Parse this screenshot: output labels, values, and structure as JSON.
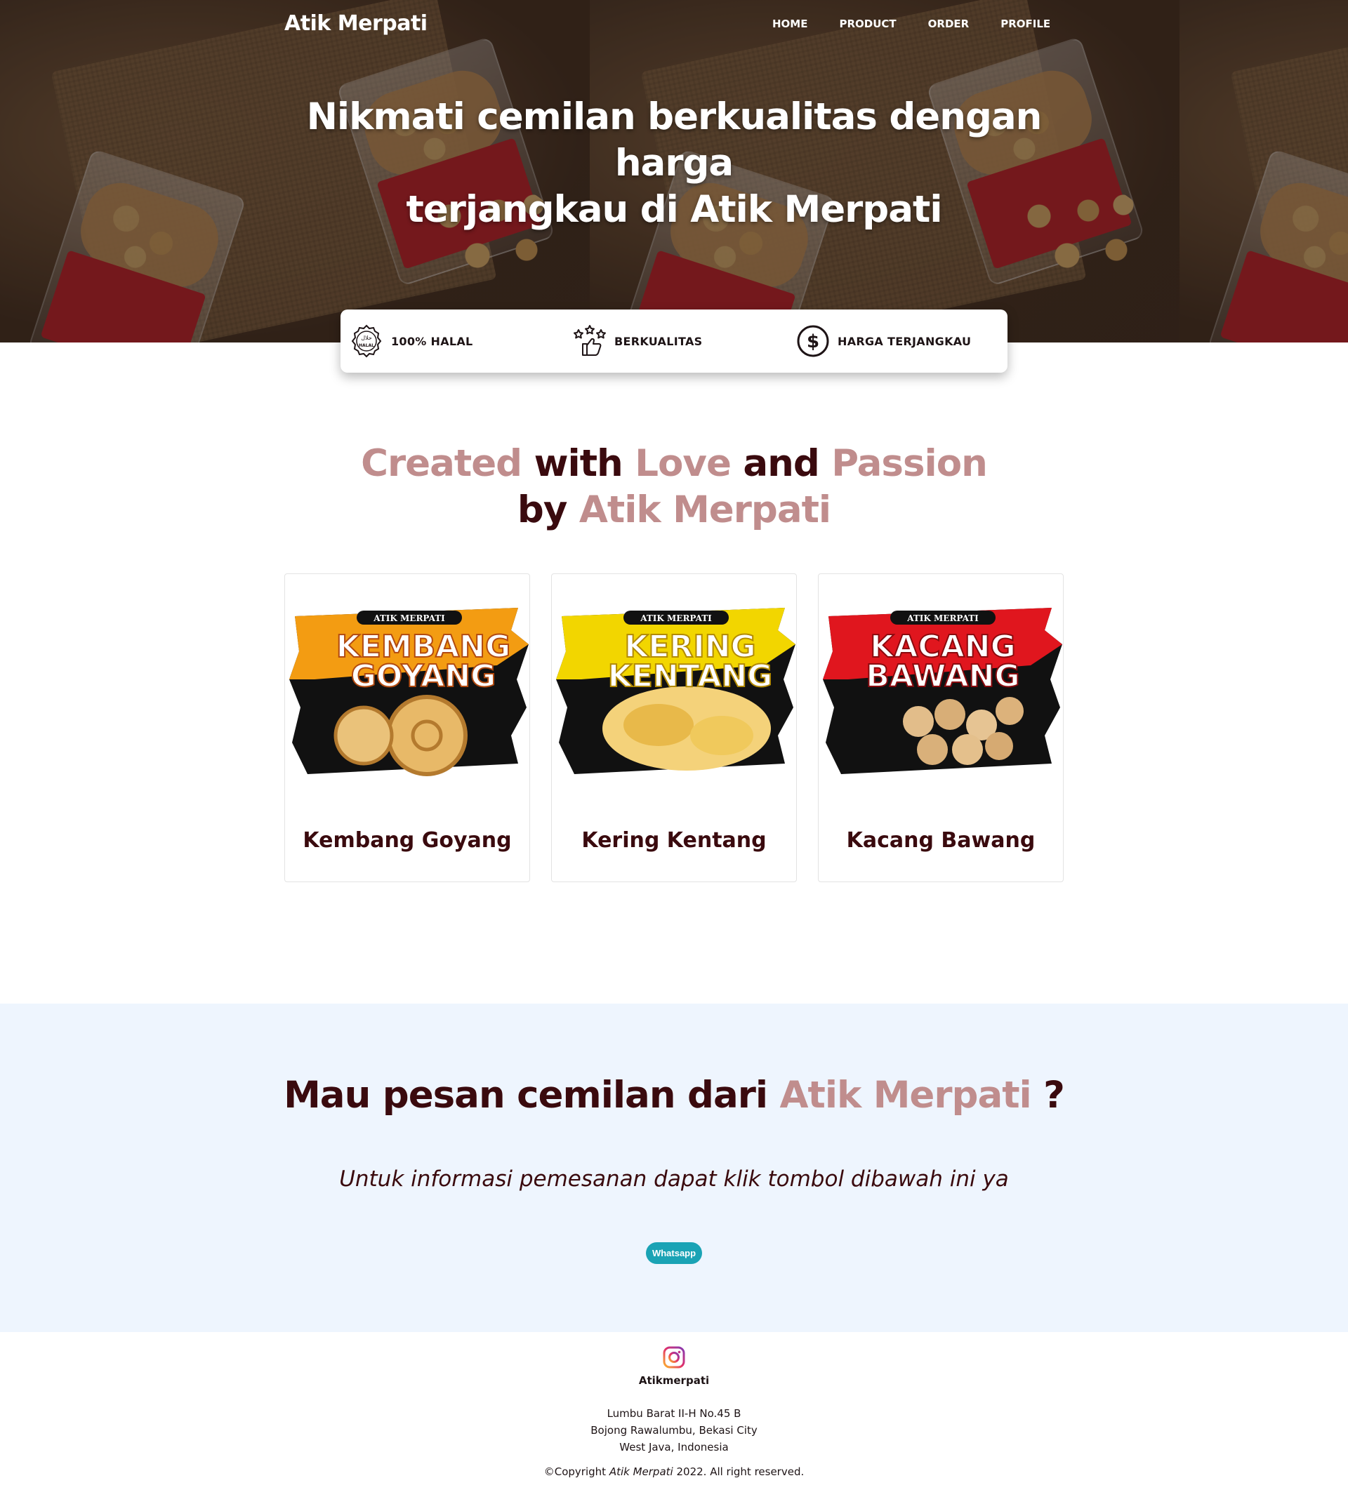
{
  "nav": {
    "brand": "Atik Merpati",
    "links": [
      "HOME",
      "PRODUCT",
      "ORDER",
      "PROFILE"
    ]
  },
  "hero": {
    "title_line1": "Nikmati cemilan berkualitas dengan harga",
    "title_line2": "terjangkau di Atik Merpati"
  },
  "features": [
    {
      "icon": "halal-icon",
      "label": "100% HALAL"
    },
    {
      "icon": "thumbs-up-stars-icon",
      "label": "BERKUALITAS"
    },
    {
      "icon": "dollar-circle-icon",
      "label": "HARGA TERJANGKAU"
    }
  ],
  "tagline": {
    "w1": "Created",
    "w2": "with",
    "w3": "Love",
    "w4": "and",
    "w5": "Passion",
    "w6": "by",
    "w7": "Atik Merpati"
  },
  "products": [
    {
      "name": "Kembang Goyang",
      "pack_brand": "ATIK MERPATI",
      "pack_line1": "KEMBANG",
      "pack_line2": "GOYANG",
      "color": "#f39c12"
    },
    {
      "name": "Kering Kentang",
      "pack_brand": "ATIK MERPATI",
      "pack_line1": "KERING",
      "pack_line2": "KENTANG",
      "color": "#f2d600"
    },
    {
      "name": "Kacang Bawang",
      "pack_brand": "ATIK MERPATI",
      "pack_line1": "KACANG",
      "pack_line2": "BAWANG",
      "color": "#e0161e"
    }
  ],
  "order": {
    "title_pre": "Mau pesan cemilan dari",
    "title_accent": "Atik Merpati",
    "title_post": "?",
    "subtitle": "Untuk informasi pemesanan dapat klik tombol dibawah ini ya",
    "button": "Whatsapp"
  },
  "footer": {
    "instagram": "Atikmerpati",
    "address_line1": "Lumbu Barat II-H No.45 B",
    "address_line2": "Bojong Rawalumbu, Bekasi City",
    "address_line3": "West Java, Indonesia",
    "copy_pre": "©Copyright",
    "copy_brand": "Atik Merpati",
    "copy_post": "2022. All right reserved."
  },
  "colors": {
    "accent": "#c08d8d",
    "dark": "#3a0a0e",
    "order_bg": "#eef5fe",
    "button": "#1aa3b5"
  }
}
